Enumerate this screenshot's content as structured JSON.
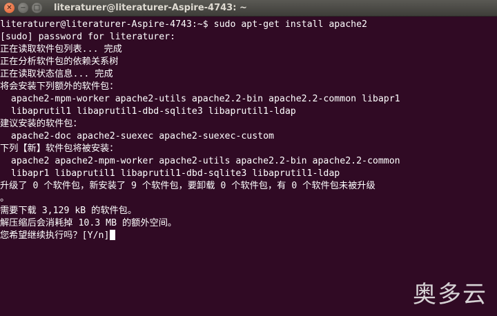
{
  "window": {
    "title": "literaturer@literaturer-Aspire-4743: ~",
    "close_symbol": "✕",
    "minimize_symbol": "−",
    "maximize_symbol": "□"
  },
  "terminal": {
    "lines": [
      "literaturer@literaturer-Aspire-4743:~$ sudo apt-get install apache2",
      "[sudo] password for literaturer:",
      "正在读取软件包列表... 完成",
      "正在分析软件包的依赖关系树",
      "正在读取状态信息... 完成",
      "将会安装下列额外的软件包：",
      "  apache2-mpm-worker apache2-utils apache2.2-bin apache2.2-common libapr1",
      "  libaprutil1 libaprutil1-dbd-sqlite3 libaprutil1-ldap",
      "建议安装的软件包：",
      "  apache2-doc apache2-suexec apache2-suexec-custom",
      "下列【新】软件包将被安装：",
      "  apache2 apache2-mpm-worker apache2-utils apache2.2-bin apache2.2-common",
      "  libapr1 libaprutil1 libaprutil1-dbd-sqlite3 libaprutil1-ldap",
      "升级了 0 个软件包，新安装了 9 个软件包，要卸载 0 个软件包，有 0 个软件包未被升级",
      "。",
      "需要下载 3,129 kB 的软件包。",
      "解压缩后会消耗掉 10.3 MB 的额外空间。",
      "您希望继续执行吗？[Y/n]"
    ]
  },
  "watermark": "奥多云"
}
